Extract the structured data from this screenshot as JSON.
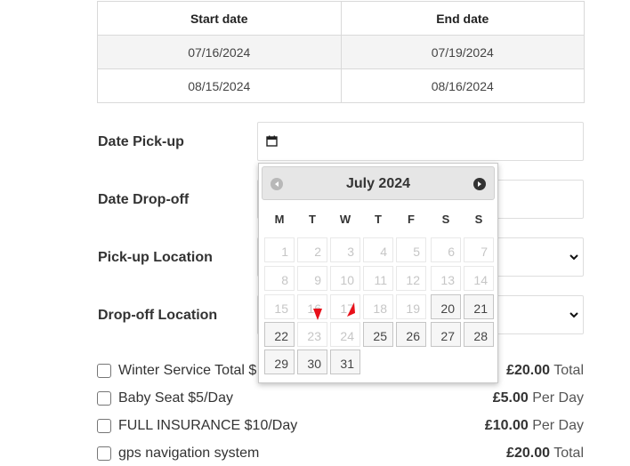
{
  "table": {
    "headers": [
      "Start date",
      "End date"
    ],
    "rows": [
      [
        "07/16/2024",
        "07/19/2024"
      ],
      [
        "08/15/2024",
        "08/16/2024"
      ]
    ]
  },
  "form": {
    "pickup_date_label": "Date Pick-up",
    "dropoff_date_label": "Date Drop-off",
    "pickup_location_label": "Pick-up Location",
    "dropoff_location_label": "Drop-off Location"
  },
  "datepicker": {
    "title": "July 2024",
    "weekdays": [
      "M",
      "T",
      "W",
      "T",
      "F",
      "S",
      "S"
    ],
    "weeks": [
      [
        "1",
        "2",
        "3",
        "4",
        "5",
        "6",
        "7"
      ],
      [
        "8",
        "9",
        "10",
        "11",
        "12",
        "13",
        "14"
      ],
      [
        "15",
        "16",
        "17",
        "18",
        "19",
        "20",
        "21"
      ],
      [
        "22",
        "23",
        "24",
        "25",
        "26",
        "27",
        "28"
      ],
      [
        "29",
        "30",
        "31"
      ]
    ],
    "prev_icon": "circle-triangle-w-icon",
    "next_icon": "circle-triangle-e-icon"
  },
  "extras": [
    {
      "label": "Winter Service Total $",
      "price": "£20.00",
      "unit": "Total"
    },
    {
      "label": "Baby Seat $5/Day",
      "price": "£5.00",
      "unit": "Per Day"
    },
    {
      "label": "FULL INSURANCE $10/Day",
      "price": "£10.00",
      "unit": "Per Day"
    },
    {
      "label": "gps navigation system",
      "price": "£20.00",
      "unit": "Total"
    }
  ],
  "colors": {
    "annotation_arrow": "#e8101a"
  }
}
